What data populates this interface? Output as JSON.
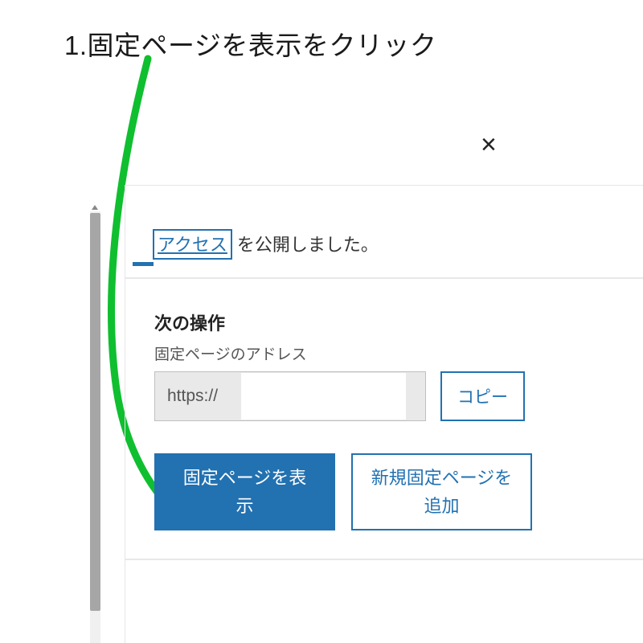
{
  "annotation": {
    "text": "1.固定ページを表示をクリック"
  },
  "dialog": {
    "close_icon": "×",
    "published": {
      "link_text": "アクセス",
      "suffix": "を公開しました。"
    },
    "next_steps": {
      "title": "次の操作",
      "address_label": "固定ページのアドレス",
      "url_prefix": "https://",
      "copy_label": "コピー"
    },
    "actions": {
      "view_page": "固定ページを表示",
      "add_new_page": "新規固定ページを追加"
    }
  }
}
